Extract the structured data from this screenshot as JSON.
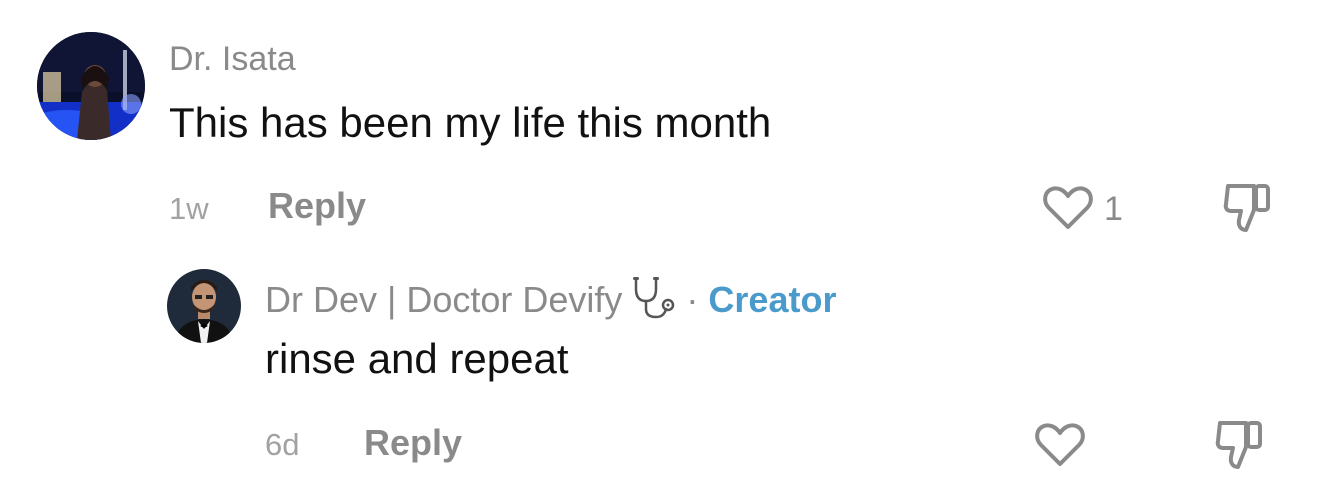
{
  "comments": [
    {
      "username": "Dr. Isata",
      "text": "This has been my life this month",
      "time": "1w",
      "reply_label": "Reply",
      "like_count": "1",
      "avatar": "avatar-photo"
    }
  ],
  "replies": [
    {
      "username": "Dr Dev | Doctor Devify",
      "name_emoji": "stethoscope-icon",
      "separator": "·",
      "badge": "Creator",
      "text": "rinse and repeat",
      "time": "6d",
      "reply_label": "Reply",
      "avatar": "avatar-photo"
    }
  ],
  "colors": {
    "muted": "#8a8a8a",
    "text": "#111111",
    "creator": "#4a9bcc"
  },
  "icons": {
    "like": "heart-outline-icon",
    "dislike": "thumbs-down-outline-icon"
  }
}
